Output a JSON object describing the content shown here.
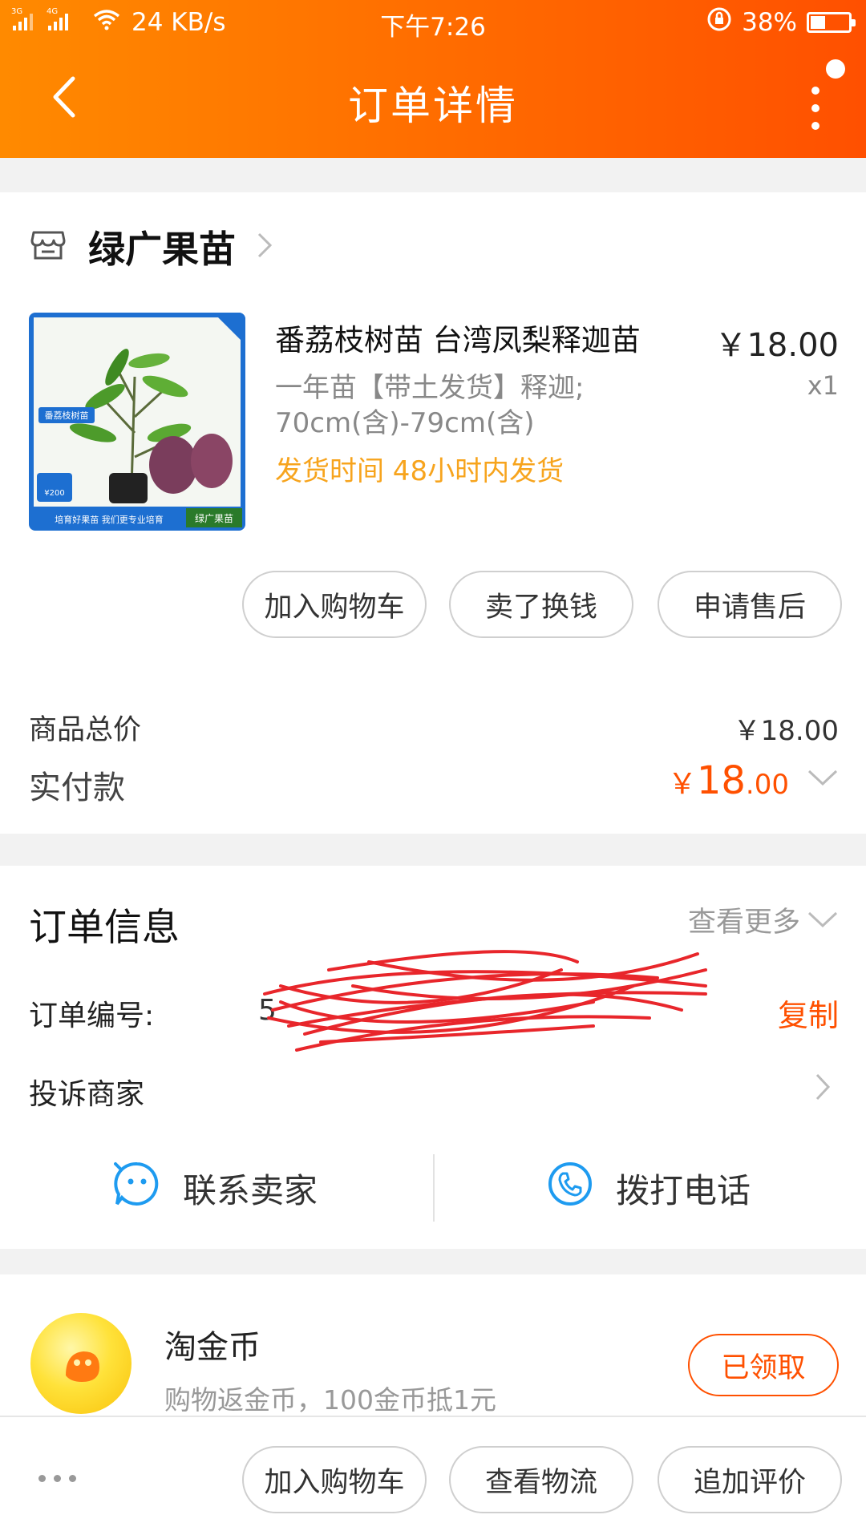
{
  "status_bar": {
    "signal_left": "3G",
    "signal_right": "4G",
    "network_speed": "24 KB/s",
    "time": "下午7:26",
    "battery_percent": "38%"
  },
  "nav": {
    "title": "订单详情"
  },
  "store": {
    "name": "绿广果苗"
  },
  "product": {
    "title": "番荔枝树苗 台湾凤梨释迦苗",
    "price": "￥18.00",
    "sku_line1": "一年苗【带土发货】释迦;",
    "sku_line2": "70cm(含)-79cm(含)",
    "quantity": "x1",
    "ship_time": "发货时间 48小时内发货",
    "image_label_main": "番荔枝树苗",
    "image_footer": "培育好果苗 我们更专业培育",
    "image_brand": "绿广果苗",
    "image_price": "¥200"
  },
  "item_actions": [
    "加入购物车",
    "卖了换钱",
    "申请售后"
  ],
  "summary": {
    "goods_total_label": "商品总价",
    "goods_total_value": "￥18.00",
    "paid_label": "实付款",
    "paid_currency": "￥",
    "paid_int": "18",
    "paid_dec": ".00"
  },
  "order_info": {
    "title": "订单信息",
    "view_more": "查看更多",
    "order_no_label": "订单编号:",
    "order_no_value": "5",
    "copy_label": "复制",
    "complain_label": "投诉商家"
  },
  "contact": {
    "seller_label": "联系卖家",
    "phone_label": "拨打电话"
  },
  "coins": {
    "title": "淘金币",
    "desc": "购物返金币，100金币抵1元",
    "button": "已领取"
  },
  "bottom_actions": [
    "加入购物车",
    "查看物流",
    "追加评价"
  ],
  "colors": {
    "accent": "#ff5000",
    "header_start": "#ff8a00",
    "ship_yellow": "#f7a41d",
    "contact_blue": "#1e9bf0"
  }
}
